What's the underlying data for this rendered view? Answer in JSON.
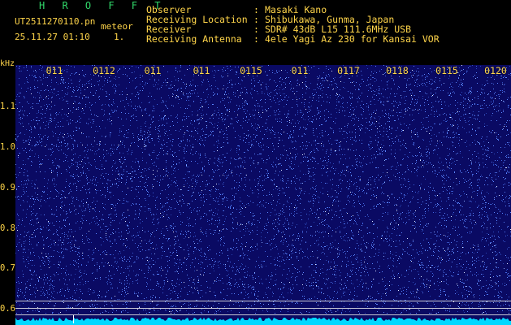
{
  "header": {
    "title": "H R O F F T",
    "file_name": "UT2511270110.pn",
    "tag": "meteor",
    "datetime": "25.11.27 01:10",
    "number": "1."
  },
  "meta": [
    {
      "label": "Observer",
      "value": "Masaki Kano"
    },
    {
      "label": "Receiving Location",
      "value": "Shibukawa, Gunma, Japan"
    },
    {
      "label": "Receiver",
      "value": "SDR# 43dB L15 111.6MHz USB"
    },
    {
      "label": "Receiving Antenna",
      "value": "4ele Yagi Az 230 for Kansai VOR"
    }
  ],
  "time_axis": {
    "labels": [
      "011",
      "0112",
      "011",
      "011",
      "0115",
      "011",
      "0117",
      "0118",
      "0115",
      "0120"
    ]
  },
  "freq_axis": {
    "unit": "kHz",
    "labels": [
      "1.1",
      "1.0",
      "0.9",
      "0.8",
      "0.7",
      "0.6"
    ],
    "min": 0.56,
    "max": 1.2
  },
  "colors": {
    "background": "#0a0a63",
    "noise": [
      "#2b49b8",
      "#3f64e0",
      "#5b86ff",
      "#8eb0ff",
      "#dce6ff"
    ],
    "trace": "#00d8ff",
    "text": "#ffd54a",
    "title": "#31d86a"
  }
}
